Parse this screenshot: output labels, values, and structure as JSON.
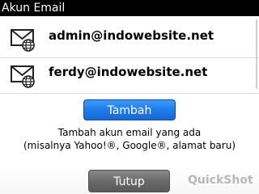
{
  "window": {
    "title": "Akun Email"
  },
  "accounts": [
    {
      "email": "admin@indowebsite.net",
      "icon": "mail-globe-icon"
    },
    {
      "email": "ferdy@indowebsite.net",
      "icon": "mail-globe-icon"
    }
  ],
  "actions": {
    "add_label": "Tambah",
    "hint_line1": "Tambah akun email yang ada",
    "hint_line2": "(misalnya Yahoo!®, Google®, alamat baru)"
  },
  "footer": {
    "close_label": "Tutup",
    "watermark": "QuickShot"
  },
  "colors": {
    "titlebar_bg": "#000000",
    "accent_blue": "#1d7bea",
    "close_gray": "#6a6a6a"
  }
}
